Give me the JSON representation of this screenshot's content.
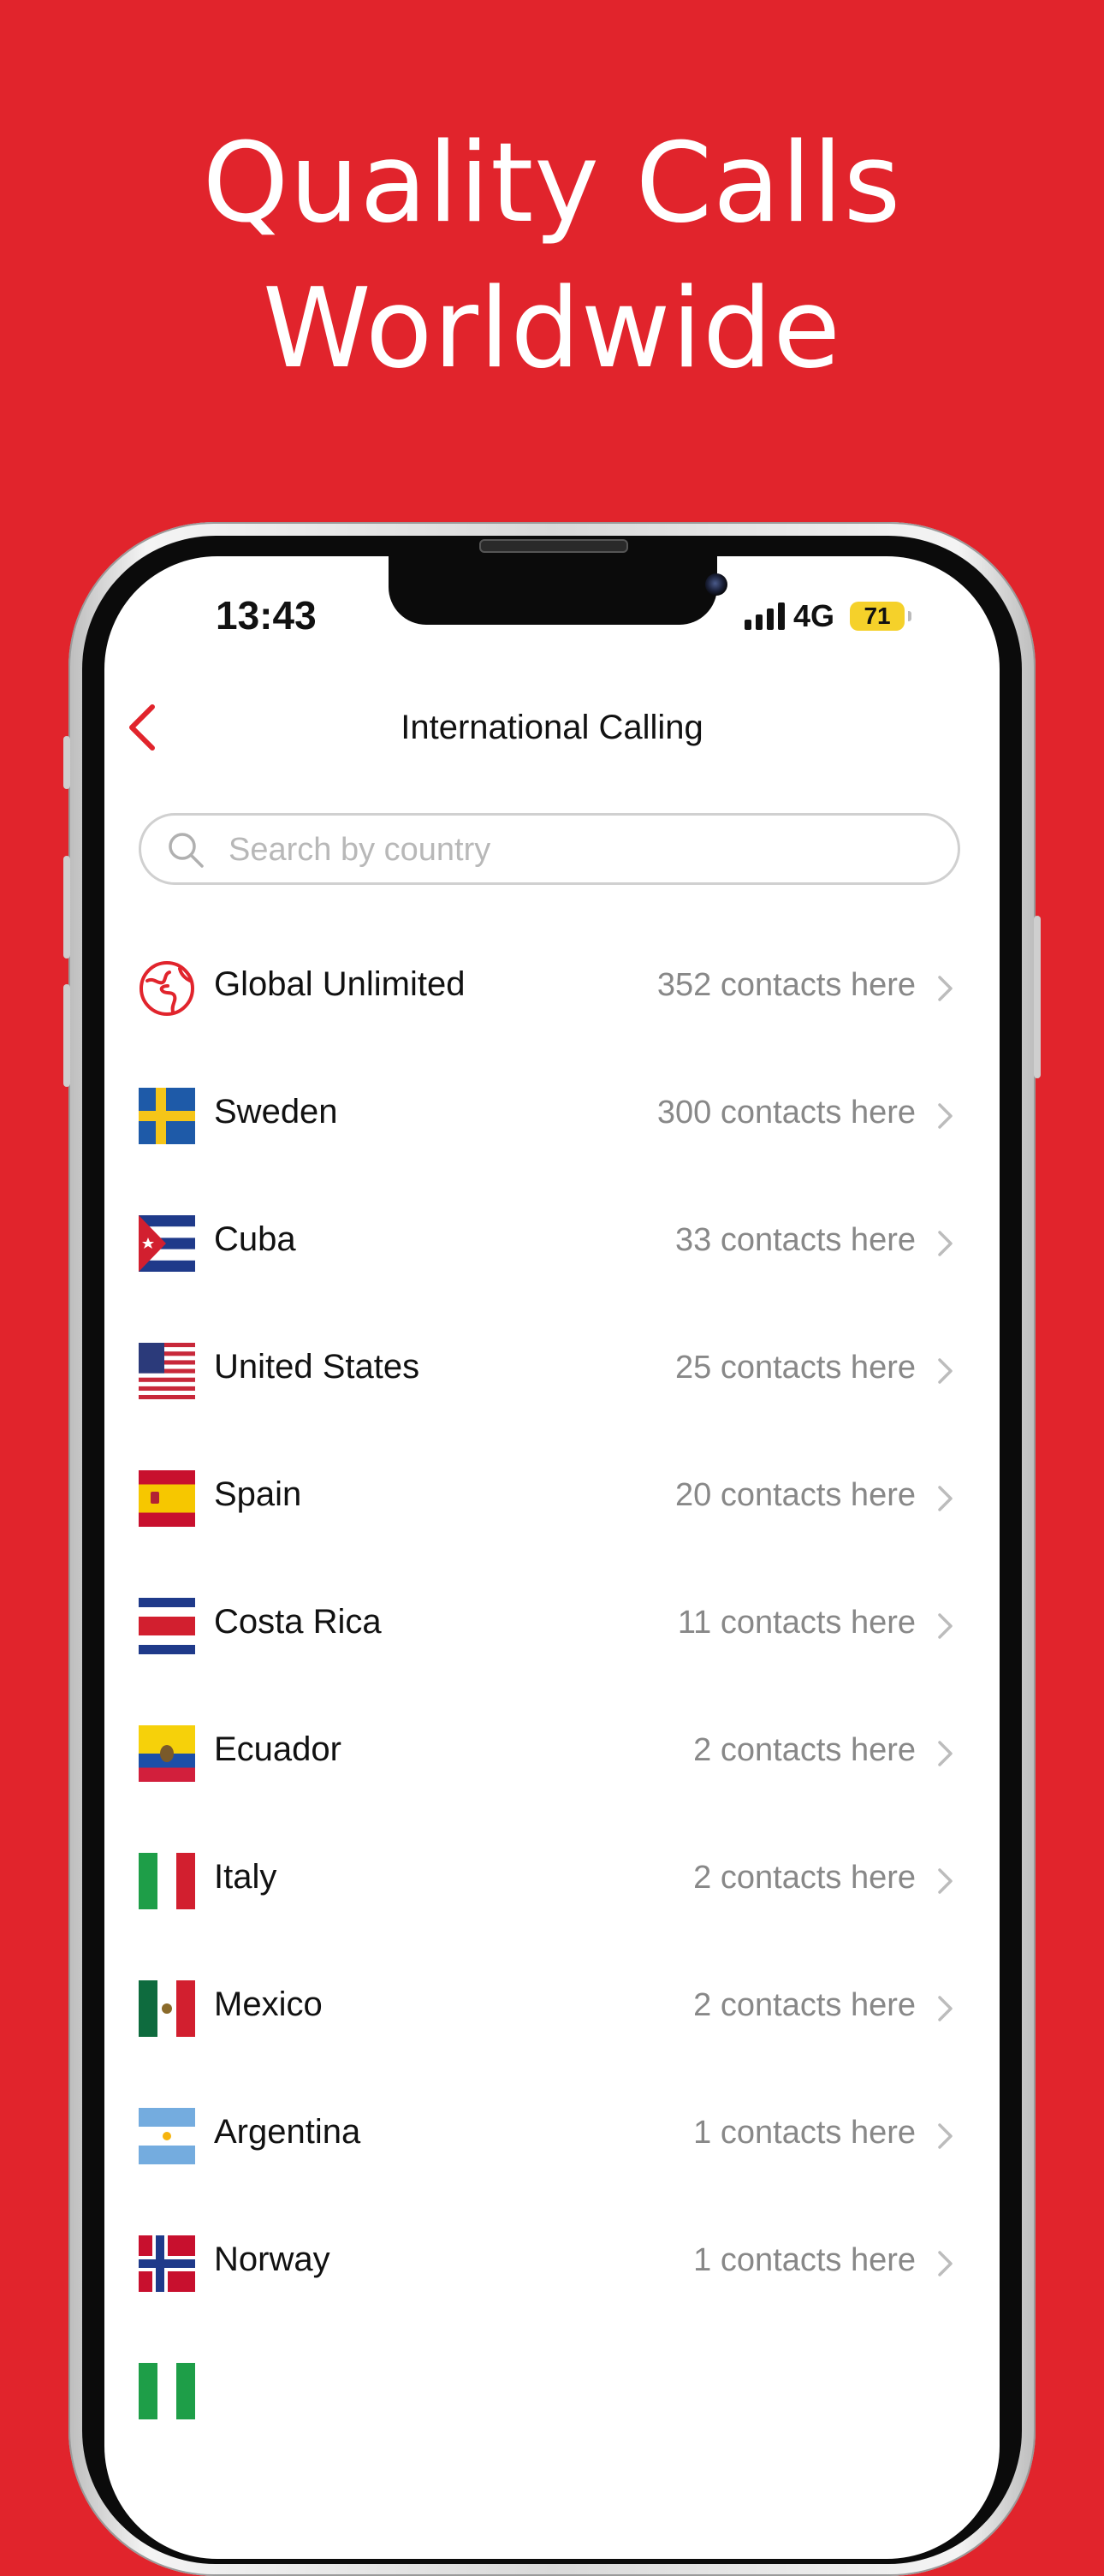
{
  "headline": {
    "line1": "Quality Calls",
    "line2": "Worldwide"
  },
  "status_bar": {
    "time": "13:43",
    "network": "4G",
    "battery": "71"
  },
  "nav": {
    "title": "International Calling"
  },
  "search": {
    "placeholder": "Search by country",
    "value": ""
  },
  "countries": [
    {
      "name": "Global Unlimited",
      "count": "352 contacts here",
      "icon": "globe-icon"
    },
    {
      "name": "Sweden",
      "count": "300 contacts here",
      "icon": "sweden-flag-icon"
    },
    {
      "name": "Cuba",
      "count": "33 contacts here",
      "icon": "cuba-flag-icon"
    },
    {
      "name": "United States",
      "count": "25 contacts here",
      "icon": "united-states-flag-icon"
    },
    {
      "name": "Spain",
      "count": "20 contacts here",
      "icon": "spain-flag-icon"
    },
    {
      "name": "Costa Rica",
      "count": "11 contacts here",
      "icon": "costa-rica-flag-icon"
    },
    {
      "name": "Ecuador",
      "count": "2 contacts here",
      "icon": "ecuador-flag-icon"
    },
    {
      "name": "Italy",
      "count": "2 contacts here",
      "icon": "italy-flag-icon"
    },
    {
      "name": "Mexico",
      "count": "2 contacts here",
      "icon": "mexico-flag-icon"
    },
    {
      "name": "Argentina",
      "count": "1 contacts here",
      "icon": "argentina-flag-icon"
    },
    {
      "name": "Norway",
      "count": "1 contacts here",
      "icon": "norway-flag-icon"
    }
  ],
  "colors": {
    "brand_red": "#E1242C",
    "text_gray": "#888888"
  }
}
